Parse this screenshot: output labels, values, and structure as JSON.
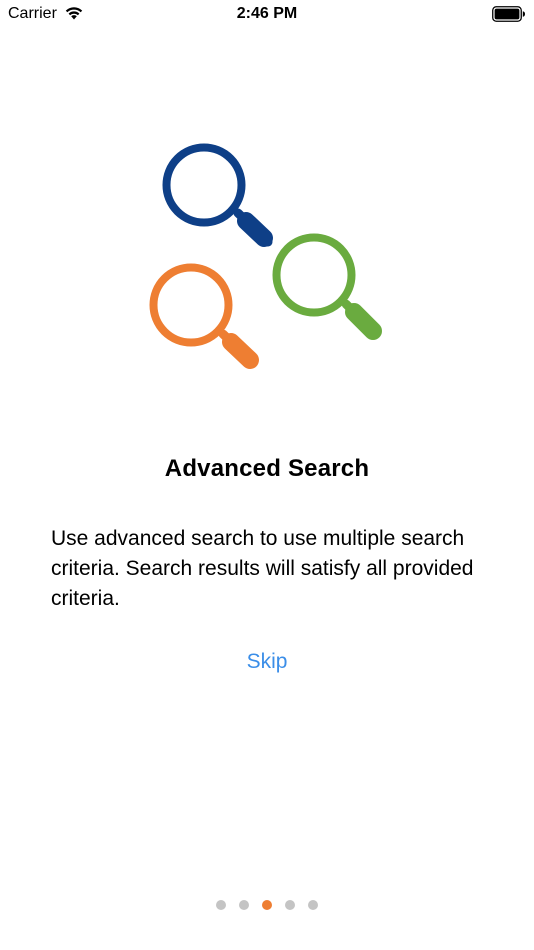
{
  "status_bar": {
    "carrier": "Carrier",
    "time": "2:46 PM",
    "icons": [
      "wifi-icon",
      "battery-icon"
    ]
  },
  "illustration": {
    "icons": [
      "magnifier-blue-icon",
      "magnifier-green-icon",
      "magnifier-orange-icon"
    ],
    "colors": {
      "blue": "#0e3f87",
      "green": "#6aab3f",
      "orange": "#ee7e32"
    }
  },
  "onboarding": {
    "title": "Advanced Search",
    "description": "Use advanced search to use multiple search criteria. Search results will satisfy all provided criteria.",
    "skip_label": "Skip",
    "skip_color": "#3b8ee8"
  },
  "pagination": {
    "total_pages": 5,
    "current_page": 3,
    "active_color": "#ee7e32",
    "inactive_color": "#c4c4c4"
  }
}
